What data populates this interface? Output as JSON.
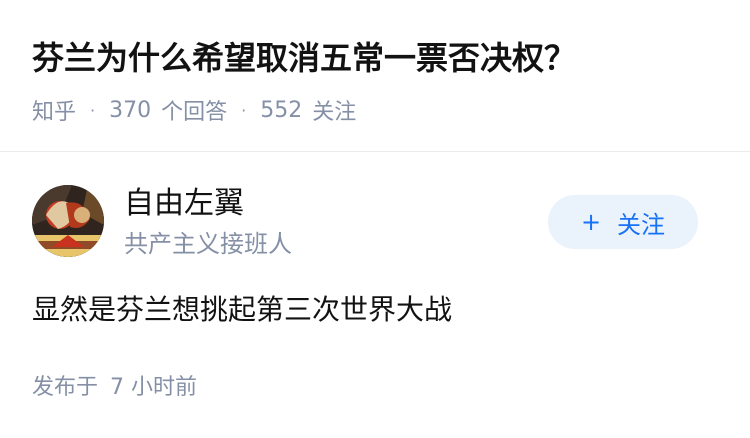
{
  "question": {
    "title": "芬兰为什么希望取消五常一票否决权？",
    "source": "知乎",
    "answer_count": "370",
    "answer_label": "个回答",
    "follower_count": "552",
    "follower_label": "关注",
    "separator": "·"
  },
  "answer": {
    "author": {
      "name": "自由左翼",
      "bio": "共产主义接班人",
      "avatar_icon": "avatar-image"
    },
    "follow_button": {
      "plus": "+",
      "label": "关注"
    },
    "content": "显然是芬兰想挑起第三次世界大战",
    "publish_prefix": "发布于",
    "publish_time": "7 小时前"
  },
  "colors": {
    "text": "#121212",
    "meta": "#8590a6",
    "accent": "#1772f6",
    "button_bg": "#eaf2fc",
    "divider": "#ebebeb"
  }
}
